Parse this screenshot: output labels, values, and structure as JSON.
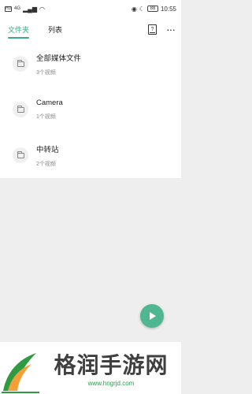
{
  "statusbar": {
    "signal_label": "HD",
    "network_label": "4G",
    "battery": "88",
    "time": "10:55"
  },
  "tabs": [
    {
      "label": "文件夹",
      "active": true
    },
    {
      "label": "列表",
      "active": false
    }
  ],
  "toolbar": {
    "help_glyph": "?",
    "more_glyph": "···"
  },
  "folders": [
    {
      "title": "全部媒体文件",
      "count": "3个视频"
    },
    {
      "title": "Camera",
      "count": "1个视频"
    },
    {
      "title": "中转站",
      "count": "2个视频"
    }
  ],
  "fab": {
    "icon": "play-icon"
  },
  "watermark": {
    "text": "格润手游网",
    "url": "www.hngrjd.com"
  },
  "colors": {
    "accent": "#3aaa8a",
    "fab": "#4fb692",
    "background": "#eeeeee"
  }
}
